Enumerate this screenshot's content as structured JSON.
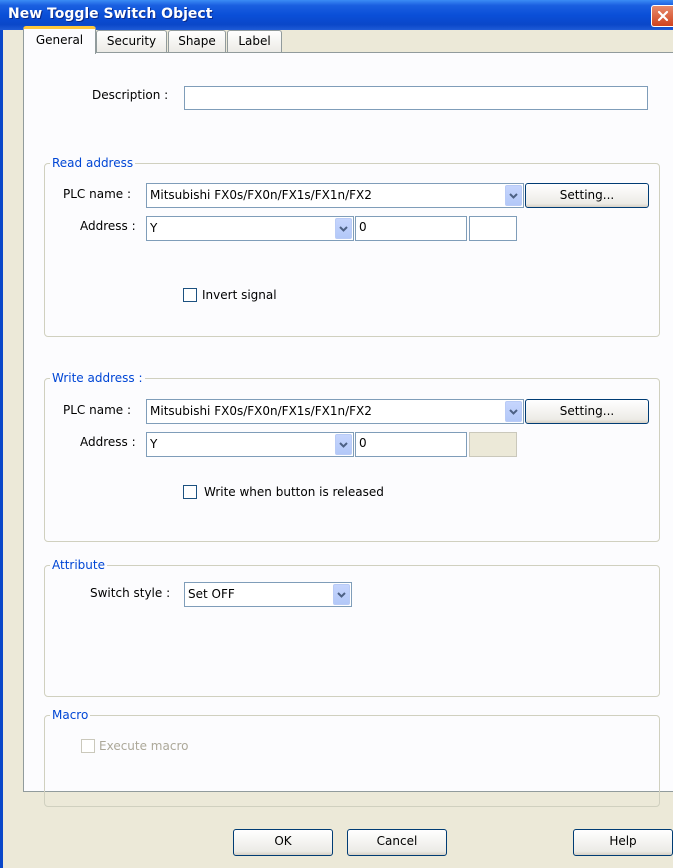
{
  "window": {
    "title": "New  Toggle Switch Object"
  },
  "tabs": [
    {
      "label": "General",
      "active": true
    },
    {
      "label": "Security",
      "active": false
    },
    {
      "label": "Shape",
      "active": false
    },
    {
      "label": "Label",
      "active": false
    }
  ],
  "description": {
    "label": "Description :",
    "value": ""
  },
  "read_address": {
    "title": "Read address",
    "plc_label": "PLC name :",
    "plc_value": "Mitsubishi FX0s/FX0n/FX1s/FX1n/FX2",
    "setting_label": "Setting...",
    "address_label": "Address :",
    "device_value": "Y",
    "address_value": "0",
    "invert_label": "Invert signal",
    "invert_checked": false
  },
  "write_address": {
    "title": "Write address :",
    "plc_label": "PLC name :",
    "plc_value": "Mitsubishi FX0s/FX0n/FX1s/FX1n/FX2",
    "setting_label": "Setting...",
    "address_label": "Address :",
    "device_value": "Y",
    "address_value": "0",
    "release_label": "Write when button is released",
    "release_checked": false
  },
  "attribute": {
    "title": "Attribute",
    "switch_style_label": "Switch style :",
    "switch_style_value": "Set OFF"
  },
  "macro": {
    "title": "Macro",
    "execute_label": "Execute macro",
    "execute_checked": false
  },
  "buttons": {
    "ok": "OK",
    "cancel": "Cancel",
    "help": "Help"
  },
  "colors": {
    "title_bar": "#0A47C9",
    "group_title": "#0046D5",
    "dialog_bg": "#ECE9D8"
  }
}
